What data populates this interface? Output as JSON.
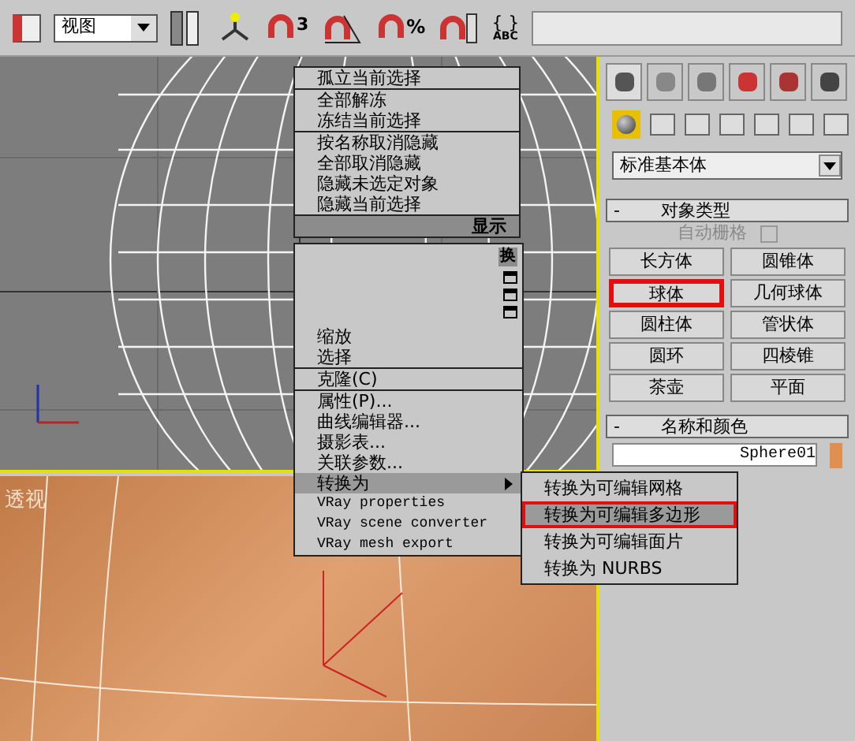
{
  "toolbar": {
    "view_select": "视图",
    "snap_count": "3",
    "percent_label": "%",
    "braces_label": "{ }",
    "abc_label": "ABC"
  },
  "viewports": {
    "perspective_label": "透视"
  },
  "quad_menu_top": {
    "items": [
      {
        "kind": "item",
        "label": "孤立当前选择",
        "separator": false
      },
      {
        "kind": "item",
        "label": "全部解冻",
        "separator": true
      },
      {
        "kind": "item",
        "label": "冻结当前选择",
        "separator": false
      },
      {
        "kind": "item",
        "label": "按名称取消隐藏",
        "separator": true
      },
      {
        "kind": "item",
        "label": "全部取消隐藏",
        "separator": false
      },
      {
        "kind": "item",
        "label": "隐藏未选定对象",
        "separator": false
      },
      {
        "kind": "item",
        "label": "隐藏当前选择",
        "separator": false
      },
      {
        "kind": "header",
        "label": "显示",
        "separator": true
      }
    ]
  },
  "quad_menu_bottom": {
    "corner_label": "换",
    "items": [
      {
        "kind": "item",
        "label": "缩放",
        "separator": false,
        "selected": false,
        "submenu": false
      },
      {
        "kind": "item",
        "label": "选择",
        "separator": false,
        "selected": false,
        "submenu": false
      },
      {
        "kind": "item",
        "label": "克隆(C)",
        "separator": true,
        "selected": false,
        "submenu": false
      },
      {
        "kind": "item",
        "label": "属性(P)...",
        "separator": true,
        "selected": false,
        "submenu": false
      },
      {
        "kind": "item",
        "label": "曲线编辑器...",
        "separator": false,
        "selected": false,
        "submenu": false
      },
      {
        "kind": "item",
        "label": "摄影表...",
        "separator": false,
        "selected": false,
        "submenu": false
      },
      {
        "kind": "item",
        "label": "关联参数...",
        "separator": false,
        "selected": false,
        "submenu": false
      },
      {
        "kind": "item",
        "label": "转换为",
        "separator": false,
        "selected": true,
        "submenu": true
      },
      {
        "kind": "plugin",
        "label": "VRay properties",
        "separator": false,
        "selected": false,
        "submenu": false
      },
      {
        "kind": "plugin",
        "label": "VRay scene converter",
        "separator": false,
        "selected": false,
        "submenu": false
      },
      {
        "kind": "plugin",
        "label": "VRay mesh export",
        "separator": false,
        "selected": false,
        "submenu": false
      }
    ]
  },
  "submenu": {
    "items": [
      {
        "label": "转换为可编辑网格",
        "selected": false,
        "highlighted": false
      },
      {
        "label": "转换为可编辑多边形",
        "selected": true,
        "highlighted": true
      },
      {
        "label": "转换为可编辑面片",
        "selected": false,
        "highlighted": false
      },
      {
        "label": "转换为 NURBS",
        "selected": false,
        "highlighted": false
      }
    ]
  },
  "command_panel": {
    "category": "标准基本体",
    "object_type": {
      "collapse_label": "-",
      "title": "对象类型",
      "autogrid": {
        "label": "自动栅格",
        "checked": false,
        "disabled": true
      },
      "buttons": [
        {
          "label": "长方体",
          "highlighted": false
        },
        {
          "label": "圆锥体",
          "highlighted": false
        },
        {
          "label": "球体",
          "highlighted": true
        },
        {
          "label": "几何球体",
          "highlighted": false
        },
        {
          "label": "圆柱体",
          "highlighted": false
        },
        {
          "label": "管状体",
          "highlighted": false
        },
        {
          "label": "圆环",
          "highlighted": false
        },
        {
          "label": "四棱锥",
          "highlighted": false
        },
        {
          "label": "茶壶",
          "highlighted": false
        },
        {
          "label": "平面",
          "highlighted": false
        }
      ]
    },
    "name_color": {
      "collapse_label": "-",
      "title": "名称和颜色",
      "name": "Sphere01",
      "color": "#e0904c"
    }
  }
}
